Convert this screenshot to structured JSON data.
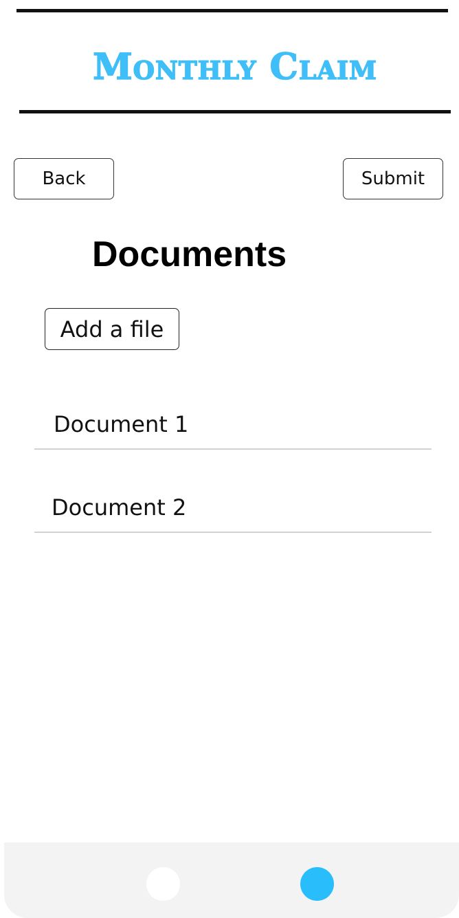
{
  "header": {
    "app_title": "Monthly Claim"
  },
  "toolbar": {
    "back_label": "Back",
    "submit_label": "Submit"
  },
  "main": {
    "page_title": "Documents",
    "add_file_label": "Add a file",
    "documents": [
      {
        "label": "Document 1"
      },
      {
        "label": "Document 2"
      }
    ]
  },
  "pager": {
    "pages": 2,
    "active_page": 2,
    "inactive_color": "#ffffff",
    "active_color": "#29bdfb"
  },
  "colors": {
    "accent": "#3fbef7",
    "text": "#111111",
    "bar_background": "#f3f3f3",
    "divider": "#d2d2d2"
  }
}
